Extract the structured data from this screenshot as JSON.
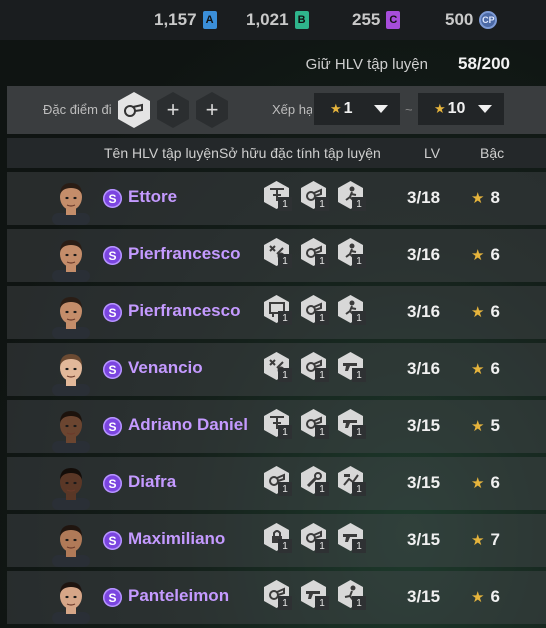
{
  "currencies": [
    {
      "value": "1,157",
      "badge": "A",
      "color": "#3b8fd9",
      "icon": "a-currency-icon"
    },
    {
      "value": "1,021",
      "badge": "B",
      "color": "#2fb58c",
      "icon": "b-currency-icon"
    },
    {
      "value": "255",
      "badge": "C",
      "color": "#a64ddb",
      "icon": "c-currency-icon"
    },
    {
      "value": "500",
      "badge": "CP",
      "color": "#4c6aa6",
      "icon": "cp-coin-icon"
    }
  ],
  "slots": {
    "label": "Giữ HLV tập luyện",
    "value": "58/200"
  },
  "filter": {
    "trait_label": "Đặc điểm đi",
    "rank_label": "Xếp hạ",
    "min_value": "1",
    "max_value": "10",
    "tilde": "~"
  },
  "columns": {
    "name": "Tên HLV tập luyện",
    "traits": "Sở hữu đặc tính tập luyện",
    "lv": "LV",
    "grade": "Bậc"
  },
  "coaches": [
    {
      "name": "Ettore",
      "lv": "3/18",
      "grade": "8",
      "traits": [
        {
          "icon": "training-icon",
          "level": "1"
        },
        {
          "icon": "whistle-icon",
          "level": "1"
        },
        {
          "icon": "player-icon",
          "level": "1"
        }
      ],
      "skin": "#c48d6a",
      "hair": "#2a1d15"
    },
    {
      "name": "Pierfrancesco",
      "lv": "3/16",
      "grade": "6",
      "traits": [
        {
          "icon": "tactics-icon",
          "level": "1"
        },
        {
          "icon": "whistle-icon",
          "level": "1"
        },
        {
          "icon": "player-icon",
          "level": "1"
        }
      ],
      "skin": "#c48d6a",
      "hair": "#2a1d15"
    },
    {
      "name": "Pierfrancesco",
      "lv": "3/16",
      "grade": "6",
      "traits": [
        {
          "icon": "board-icon",
          "level": "1"
        },
        {
          "icon": "whistle-icon",
          "level": "1"
        },
        {
          "icon": "player-icon",
          "level": "1"
        }
      ],
      "skin": "#c48d6a",
      "hair": "#2a1d15"
    },
    {
      "name": "Venancio",
      "lv": "3/16",
      "grade": "6",
      "traits": [
        {
          "icon": "tactics-icon",
          "level": "1"
        },
        {
          "icon": "whistle-icon",
          "level": "1"
        },
        {
          "icon": "gun-icon",
          "level": "1"
        }
      ],
      "skin": "#e2b89a",
      "hair": "#6b4a32"
    },
    {
      "name": "Adriano Daniel",
      "lv": "3/15",
      "grade": "5",
      "traits": [
        {
          "icon": "training-icon",
          "level": "1"
        },
        {
          "icon": "whistle-icon",
          "level": "1"
        },
        {
          "icon": "gun-icon",
          "level": "1"
        }
      ],
      "skin": "#6b4530",
      "hair": "#1c120c"
    },
    {
      "name": "Diafra",
      "lv": "3/15",
      "grade": "6",
      "traits": [
        {
          "icon": "whistle-icon",
          "level": "1"
        },
        {
          "icon": "wrench-icon",
          "level": "1"
        },
        {
          "icon": "chart-icon",
          "level": "1"
        }
      ],
      "skin": "#5a3726",
      "hair": "#140d09"
    },
    {
      "name": "Maximiliano",
      "lv": "3/15",
      "grade": "7",
      "traits": [
        {
          "icon": "lock-icon",
          "level": "1"
        },
        {
          "icon": "whistle-icon",
          "level": "1"
        },
        {
          "icon": "gun-icon",
          "level": "1"
        }
      ],
      "skin": "#b07a58",
      "hair": "#20150f"
    },
    {
      "name": "Panteleimon",
      "lv": "3/15",
      "grade": "6",
      "traits": [
        {
          "icon": "whistle-icon",
          "level": "1"
        },
        {
          "icon": "gun-icon",
          "level": "1"
        },
        {
          "icon": "kick-icon",
          "level": "1"
        }
      ],
      "skin": "#d6a688",
      "hair": "#1e1410"
    }
  ]
}
